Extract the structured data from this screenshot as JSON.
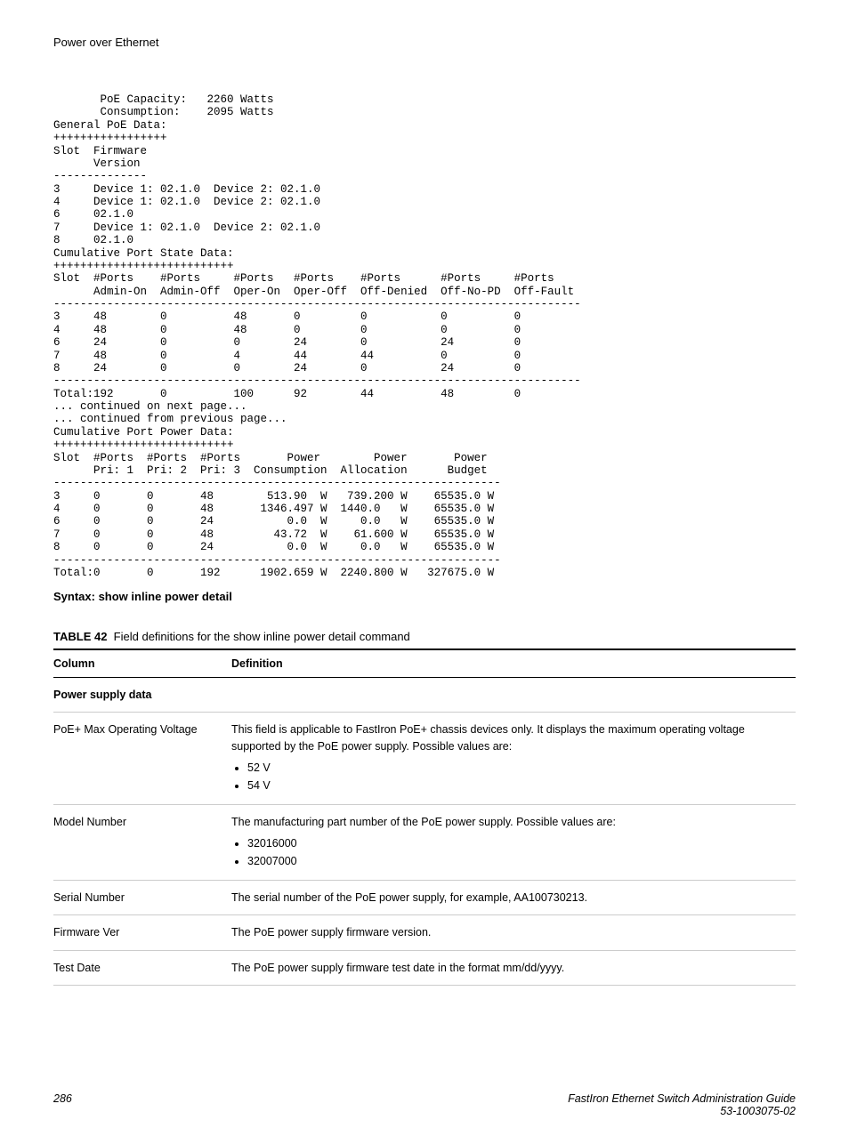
{
  "header": {
    "title": "Power over Ethernet"
  },
  "cli": "       PoE Capacity:   2260 Watts\n       Consumption:    2095 Watts\nGeneral PoE Data:\n+++++++++++++++++\nSlot  Firmware\n      Version\n--------------\n3     Device 1: 02.1.0  Device 2: 02.1.0\n4     Device 1: 02.1.0  Device 2: 02.1.0\n6     02.1.0\n7     Device 1: 02.1.0  Device 2: 02.1.0\n8     02.1.0\nCumulative Port State Data:\n+++++++++++++++++++++++++++\nSlot  #Ports    #Ports     #Ports   #Ports    #Ports      #Ports     #Ports\n      Admin-On  Admin-Off  Oper-On  Oper-Off  Off-Denied  Off-No-PD  Off-Fault\n-------------------------------------------------------------------------------\n3     48        0          48       0         0           0          0\n4     48        0          48       0         0           0          0\n6     24        0          0        24        0           24         0\n7     48        0          4        44        44          0          0\n8     24        0          0        24        0           24         0\n-------------------------------------------------------------------------------\nTotal:192       0          100      92        44          48         0\n... continued on next page...\n... continued from previous page...\nCumulative Port Power Data:\n+++++++++++++++++++++++++++\nSlot  #Ports  #Ports  #Ports       Power        Power       Power\n      Pri: 1  Pri: 2  Pri: 3  Consumption  Allocation      Budget\n-------------------------------------------------------------------\n3     0       0       48        513.90  W   739.200 W    65535.0 W\n4     0       0       48       1346.497 W  1440.0   W    65535.0 W\n6     0       0       24           0.0  W     0.0   W    65535.0 W\n7     0       0       48         43.72  W    61.600 W    65535.0 W\n8     0       0       24           0.0  W     0.0   W    65535.0 W\n-------------------------------------------------------------------\nTotal:0       0       192      1902.659 W  2240.800 W   327675.0 W",
  "syntax": "Syntax: show inline power detail",
  "table": {
    "caption_label": "TABLE 42",
    "caption_text": "Field definitions for the show inline power detail command",
    "head": {
      "c1": "Column",
      "c2": "Definition"
    },
    "section1": "Power supply data",
    "rows": {
      "r1": {
        "col": "PoE+ Max Operating Voltage",
        "def": "This field is applicable to FastIron PoE+ chassis devices only. It displays the maximum operating voltage supported by the PoE power supply. Possible values are:",
        "v1": "52 V",
        "v2": "54 V"
      },
      "r2": {
        "col": "Model Number",
        "def": "The manufacturing part number of the PoE power supply. Possible values are:",
        "v1": "32016000",
        "v2": "32007000"
      },
      "r3": {
        "col": "Serial Number",
        "def": "The serial number of the PoE power supply, for example, AA100730213."
      },
      "r4": {
        "col": "Firmware Ver",
        "def": "The PoE power supply firmware version."
      },
      "r5": {
        "col": "Test Date",
        "def": "The PoE power supply firmware test date in the format mm/dd/yyyy."
      }
    }
  },
  "footer": {
    "page": "286",
    "doc1": "FastIron Ethernet Switch Administration Guide",
    "doc2": "53-1003075-02"
  }
}
